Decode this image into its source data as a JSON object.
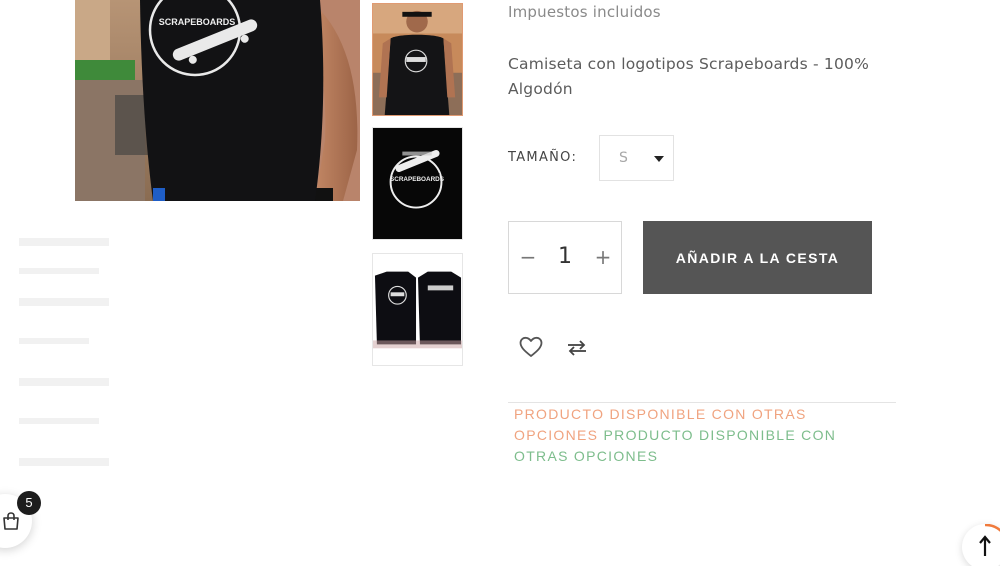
{
  "product": {
    "taxes_note": "Impuestos incluidos",
    "description": "Camiseta con logotipos Scrapeboards - 100% Algodón",
    "image_logo_text": "SCRAPEBOARDS"
  },
  "options": {
    "size_label": "TAMAÑO:",
    "size_selected": "S"
  },
  "cart_form": {
    "quantity": "1",
    "minus_symbol": "−",
    "plus_symbol": "+",
    "add_button_label": "AÑADIR A LA CESTA"
  },
  "availability": {
    "text_1": "PRODUCTO DISPONIBLE CON OTRAS OPCIONES",
    "text_2": "PRODUCTO DISPONIBLE CON OTRAS OPCIONES",
    "color_1": "#f0a37f",
    "color_2": "#7dbd8c"
  },
  "floating_cart": {
    "count": "5"
  },
  "icons": {
    "wishlist": "heart-icon",
    "compare": "compare-arrows-icon",
    "cart": "shopping-bag-icon",
    "back_to_top": "arrow-up-icon"
  },
  "colors": {
    "button_bg": "#555555",
    "thumb_active_border": "#e09a72"
  }
}
